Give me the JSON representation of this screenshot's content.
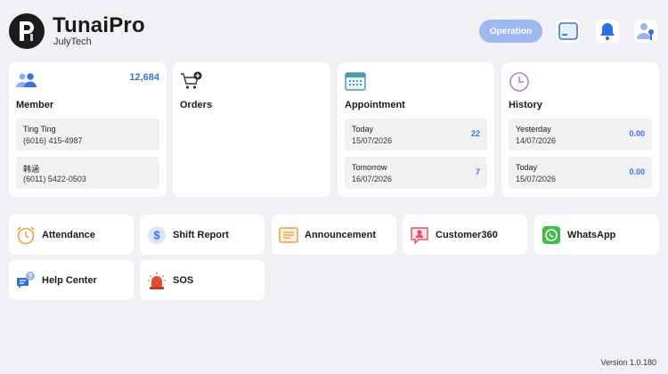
{
  "app": {
    "title": "TunaiPro",
    "subtitle": "JulyTech"
  },
  "header": {
    "operation_label": "Operation"
  },
  "cards": {
    "member": {
      "title": "Member",
      "count": "12,684",
      "rows": [
        {
          "name": "Ting Ting",
          "phone": "(6016) 415-4987"
        },
        {
          "name": "韩涵",
          "phone": "(6011) 5422-0503"
        }
      ]
    },
    "orders": {
      "title": "Orders"
    },
    "appointment": {
      "title": "Appointment",
      "rows": [
        {
          "label": "Today",
          "date": "15/07/2026",
          "value": "22"
        },
        {
          "label": "Tomorrow",
          "date": "16/07/2026",
          "value": "7"
        }
      ]
    },
    "history": {
      "title": "History",
      "rows": [
        {
          "label": "Yesterday",
          "date": "14/07/2026",
          "value": "0.00"
        },
        {
          "label": "Today",
          "date": "15/07/2026",
          "value": "0.00"
        }
      ]
    }
  },
  "tiles": [
    {
      "label": "Attendance",
      "icon": "alarm-clock-icon"
    },
    {
      "label": "Shift Report",
      "icon": "dollar-icon"
    },
    {
      "label": "Announcement",
      "icon": "announcement-icon"
    },
    {
      "label": "Customer360",
      "icon": "customer-icon"
    },
    {
      "label": "WhatsApp",
      "icon": "whatsapp-icon"
    },
    {
      "label": "Help Center",
      "icon": "help-chat-icon"
    },
    {
      "label": "SOS",
      "icon": "siren-icon"
    }
  ],
  "colors": {
    "accent": "#3a73d9",
    "operation_button": "#9db9f0",
    "background": "#f1f1f5"
  },
  "footer": {
    "version": "Version 1.0.180"
  }
}
